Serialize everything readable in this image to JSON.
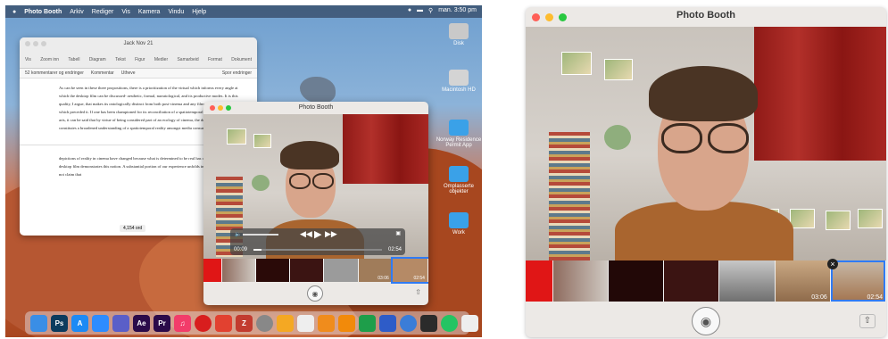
{
  "left": {
    "menubar": {
      "app": "Photo Booth",
      "items": [
        "Arkiv",
        "Rediger",
        "Vis",
        "Kamera",
        "Vindu",
        "Hjelp"
      ],
      "clock": "man. 3:50 pm"
    },
    "desktop_icons": [
      "Disk",
      "Macintosh HD",
      "Norway Residence Permit App",
      "Omplasserte objekter",
      "Work"
    ],
    "pages_window": {
      "title": "Jack Nov 21",
      "toolbar": [
        "Vis",
        "Zoom inn",
        "Tabell",
        "Diagram",
        "Tekst",
        "Figur",
        "Medier",
        "Samarbeid",
        "Format",
        "Dokument"
      ],
      "comments": "52 kommentarer og endringer",
      "comment_btn": "Kommentar",
      "highlight_btn": "Utheve",
      "track_btn": "Spor endringer",
      "paragraph_1": "As can be seen in these three propositions, there is a prioritization of the virtual which informs every angle at which the desktop film can be discussed- aesthetic, formal, narratological, and its productive modes. It is this quality, I argue, that makes its ontologically distinct from both post-cinema and any filmmaking format which preceded it. If one has been championed for its reconciliation of a spatiotemporal reality within the arts, it can be said that by virtue of being considered part of an ecology of cinema, the desktop film constitutes a broadened understanding of a spatiotemporal reality amongst media consumers. I",
      "paragraph_2": "depictions of reality in cinema have changed because what is determined to be real has changed, and the desktop film demonstrates this notion. A substantial portion of our experience unfolds in virtual space. I do not claim that",
      "word_count": "4,154 ord"
    },
    "photo_booth_small": {
      "title": "Photo Booth",
      "time_elapsed": "00:09",
      "time_total": "02:54",
      "thumb_durations": [
        "03:06",
        "02:54"
      ]
    }
  },
  "right": {
    "photo_booth": {
      "title": "Photo Booth",
      "thumb_durations": [
        "03:06",
        "02:54"
      ]
    }
  },
  "colors": {
    "accent": "#2f7bf5",
    "close": "#ff5f57",
    "minimize": "#febc2e",
    "zoom": "#28c840"
  }
}
